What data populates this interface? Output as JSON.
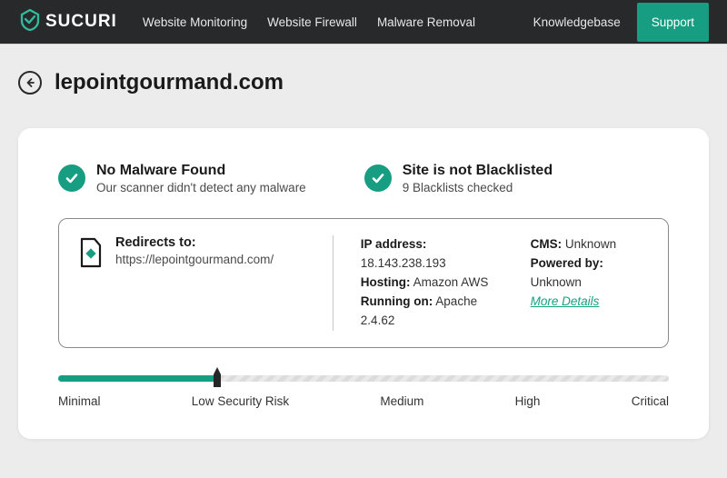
{
  "brand": "SUCURI",
  "nav": {
    "monitoring": "Website Monitoring",
    "firewall": "Website Firewall",
    "malware": "Malware Removal",
    "kb": "Knowledgebase",
    "support": "Support"
  },
  "page": {
    "domain": "lepointgourmand.com"
  },
  "status": {
    "malware": {
      "title": "No Malware Found",
      "sub": "Our scanner didn't detect any malware"
    },
    "blacklist": {
      "title": "Site is not Blacklisted",
      "sub": "9 Blacklists checked"
    }
  },
  "redirect": {
    "label": "Redirects to:",
    "url": "https://lepointgourmand.com/"
  },
  "server": {
    "ip_label": "IP address:",
    "ip": "18.143.238.193",
    "hosting_label": "Hosting:",
    "hosting": "Amazon AWS",
    "running_label": "Running on:",
    "running": "Apache 2.4.62",
    "cms_label": "CMS:",
    "cms": "Unknown",
    "powered_label": "Powered by:",
    "powered": "Unknown",
    "more": "More Details"
  },
  "risk": {
    "levels": {
      "minimal": "Minimal",
      "low": "Low Security Risk",
      "medium": "Medium",
      "high": "High",
      "critical": "Critical"
    },
    "fill_percent": 26
  },
  "colors": {
    "accent": "#179e82"
  }
}
